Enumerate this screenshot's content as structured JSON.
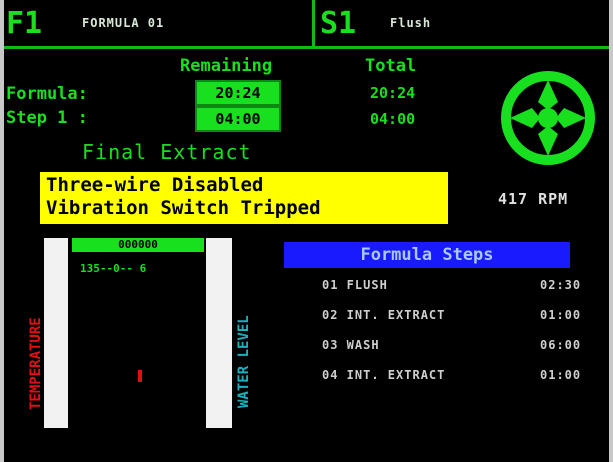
{
  "header": {
    "left_key": "F1",
    "left_title": "FORMULA 01",
    "right_key": "S1",
    "right_title": "Flush"
  },
  "timers": {
    "remaining_label": "Remaining",
    "total_label": "Total",
    "formula_label": "Formula:",
    "step_label": "Step 1 :",
    "formula_remaining": "20:24",
    "step_remaining": "04:00",
    "formula_total": "20:24",
    "step_total": "04:00"
  },
  "status": {
    "phase": "Final Extract",
    "alarm_line1": "Three-wire Disabled",
    "alarm_line2": "Vibration Switch Tripped"
  },
  "drum": {
    "rpm": "417 RPM",
    "icon": "drum-rotation-icon"
  },
  "gauge": {
    "left_label": "TEMPERATURE",
    "right_label": "WATER LEVEL",
    "top_value": "000000",
    "sub_value": "135--0-- 6"
  },
  "steps": {
    "header": "Formula Steps",
    "items": [
      {
        "name": "01 FLUSH",
        "time": "02:30"
      },
      {
        "name": "02 INT. EXTRACT",
        "time": "01:00"
      },
      {
        "name": "03 WASH",
        "time": "06:00"
      },
      {
        "name": "04 INT. EXTRACT",
        "time": "01:00"
      }
    ]
  },
  "colors": {
    "screen_green": "#19e01f",
    "alarm_yellow": "#ffff00",
    "steps_blue": "#1a1aff",
    "temp_red": "#e01010",
    "level_cyan": "#1ab0c0"
  }
}
